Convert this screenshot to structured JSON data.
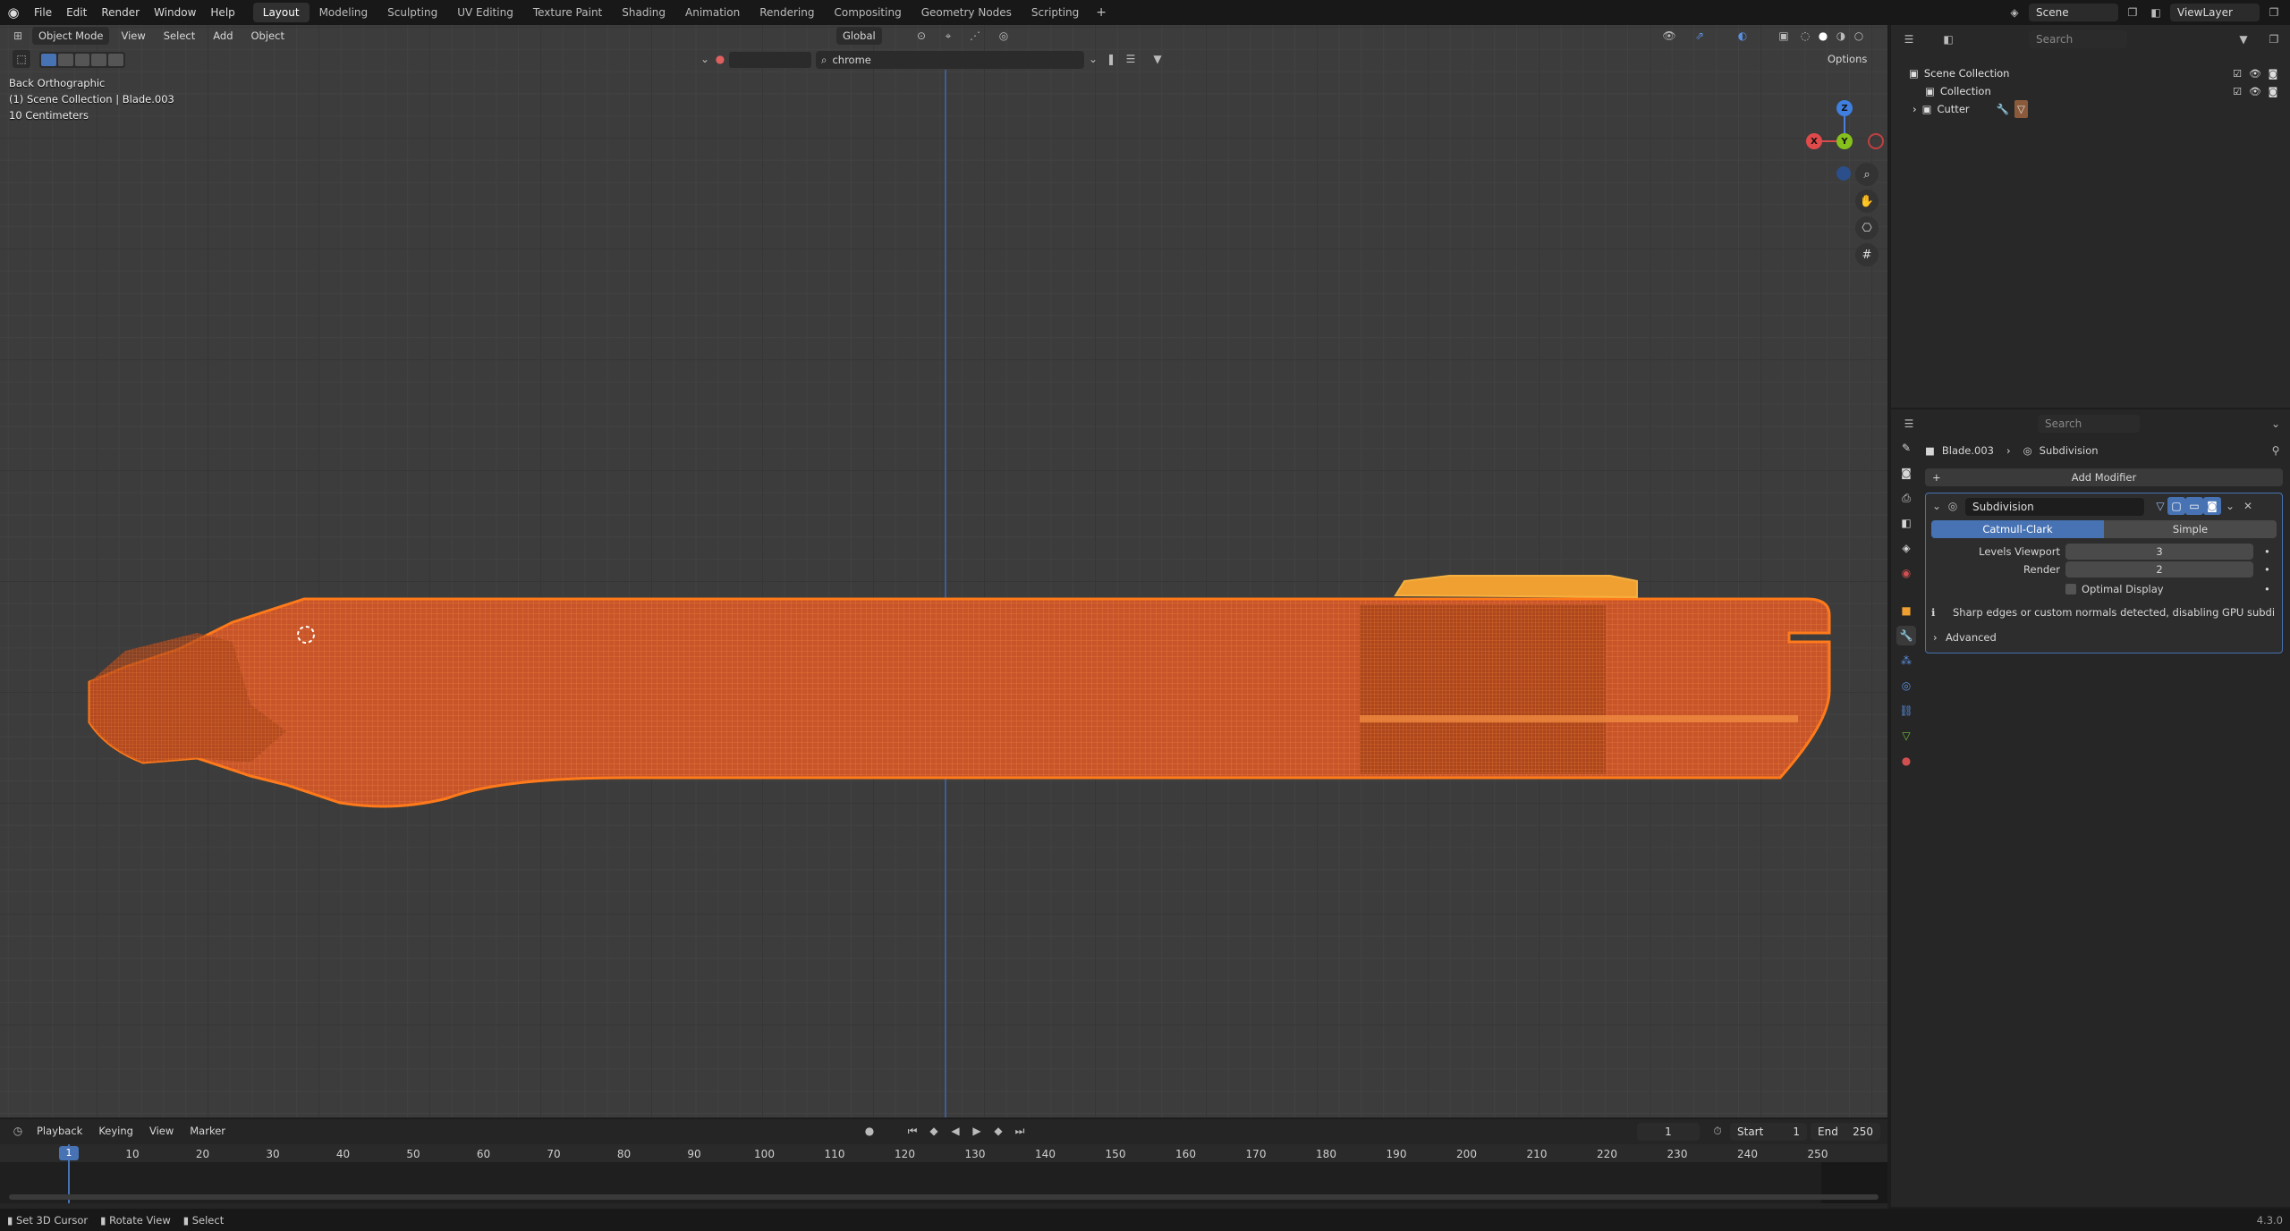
{
  "menu": {
    "items": [
      "File",
      "Edit",
      "Render",
      "Window",
      "Help"
    ]
  },
  "workspaces": [
    "Layout",
    "Modeling",
    "Sculpting",
    "UV Editing",
    "Texture Paint",
    "Shading",
    "Animation",
    "Rendering",
    "Compositing",
    "Geometry Nodes",
    "Scripting"
  ],
  "workspace_add": "+",
  "top_right": {
    "scene": "Scene",
    "view_layer": "ViewLayer"
  },
  "viewport": {
    "mode": "Object Mode",
    "menus": [
      "View",
      "Select",
      "Add",
      "Object"
    ],
    "transform_orientation": "Global",
    "search_value": "chrome",
    "options_label": "Options",
    "overlay": [
      "Back Orthographic",
      "(1) Scene Collection | Blade.003",
      "10 Centimeters"
    ],
    "gizmo": {
      "z": "Z",
      "y": "Y",
      "x": "X"
    },
    "nav_icons": [
      "zoom-icon",
      "hand-icon",
      "camera-icon",
      "grid-icon"
    ]
  },
  "outliner": {
    "search_placeholder": "Search",
    "rows": [
      "Scene Collection",
      "Collection",
      "Cutter"
    ]
  },
  "properties": {
    "search_placeholder": "Search",
    "breadcrumb": {
      "object": "Blade.003",
      "modifier": "Subdivision"
    },
    "add_modifier": "Add Modifier",
    "modifier": {
      "name": "Subdivision",
      "type_options": [
        "Catmull-Clark",
        "Simple"
      ],
      "selected_type": "Catmull-Clark",
      "levels_viewport_label": "Levels Viewport",
      "levels_viewport": "3",
      "render_label": "Render",
      "render": "2",
      "optimal_display_label": "Optimal Display",
      "optimal_display_checked": false,
      "warning": "Sharp edges or custom normals detected, disabling GPU subdivis...",
      "advanced_label": "Advanced"
    }
  },
  "timeline": {
    "menus": [
      "Playback",
      "Keying",
      "View",
      "Marker"
    ],
    "current_frame": "1",
    "start_label": "Start",
    "start": "1",
    "end_label": "End",
    "end": "250",
    "ticks": [
      "10",
      "20",
      "30",
      "40",
      "50",
      "60",
      "70",
      "80",
      "90",
      "100",
      "110",
      "120",
      "130",
      "140",
      "150",
      "160",
      "170",
      "180",
      "190",
      "200",
      "210",
      "220",
      "230",
      "240",
      "250"
    ],
    "playhead": "1"
  },
  "status": {
    "items": [
      "Set 3D Cursor",
      "Rotate View",
      "Select"
    ],
    "version": "4.3.0"
  },
  "colors": {
    "accent": "#4772b3",
    "mesh": "#e8661e",
    "selected_part": "#f0a030"
  }
}
